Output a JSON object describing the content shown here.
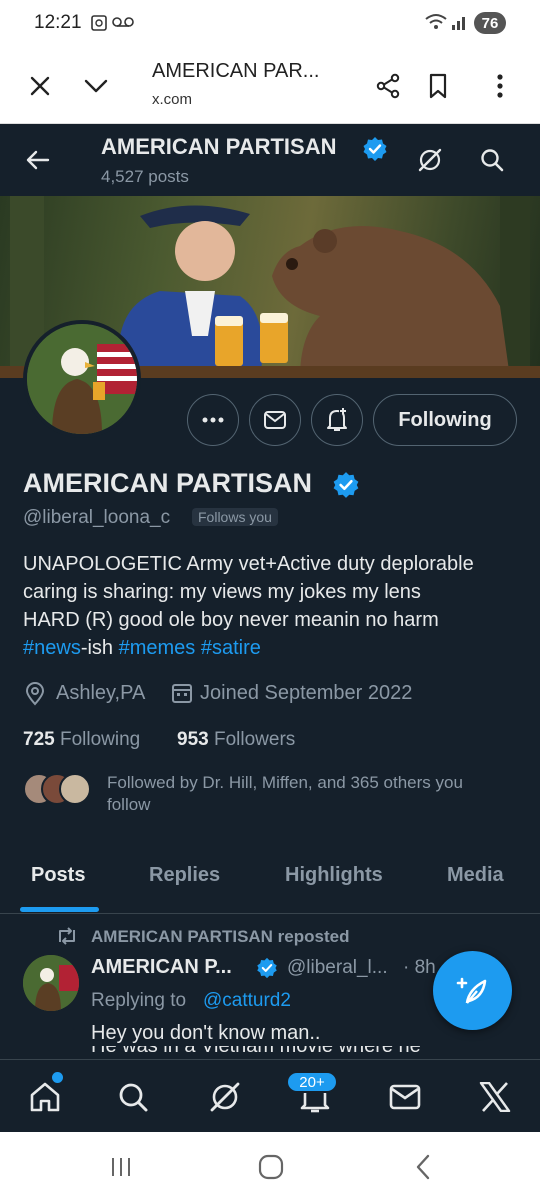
{
  "status": {
    "time": "12:21",
    "battery": "76"
  },
  "browser": {
    "title": "AMERICAN PAR...",
    "url": "x.com"
  },
  "header": {
    "name": "AMERICAN PARTISAN",
    "posts_count": "4,527 posts"
  },
  "profile": {
    "name": "AMERICAN PARTISAN",
    "handle": "@liberal_loona_c",
    "follows_you": "Follows you",
    "following_button": "Following",
    "bio_lines": [
      "UNAPOLOGETIC Army vet+Active duty deplorable",
      "caring is sharing: my views my jokes my lens",
      "HARD (R)  good ole boy never meanin no harm"
    ],
    "bio_tags": {
      "news": "#news",
      "ish": "-ish",
      "memes": "#memes",
      "satire": "#satire"
    },
    "location": "Ashley,PA",
    "joined": "Joined September 2022",
    "following_count": "725",
    "following_label": "Following",
    "followers_count": "953",
    "followers_label": "Followers",
    "followed_by_line1": "Followed by Dr. Hill, Miffen, and 365 others you",
    "followed_by_line2": "follow"
  },
  "tabs": [
    "Posts",
    "Replies",
    "Highlights",
    "Media"
  ],
  "post": {
    "repost_label": "AMERICAN PARTISAN reposted",
    "author": "AMERICAN P...",
    "handle": "@liberal_l...",
    "time": "· 8h",
    "replying_to_label": "Replying to",
    "replying_to_handle": "@catturd2",
    "text": "Hey you don't know man..",
    "text_cut": "He was in a Vietnam movie where he"
  },
  "bottom_nav": {
    "notifications_badge": "20+"
  },
  "colors": {
    "background": "#15202b",
    "accent": "#1d9bf0",
    "text": "#e7e9ea",
    "muted": "#8b98a5"
  }
}
